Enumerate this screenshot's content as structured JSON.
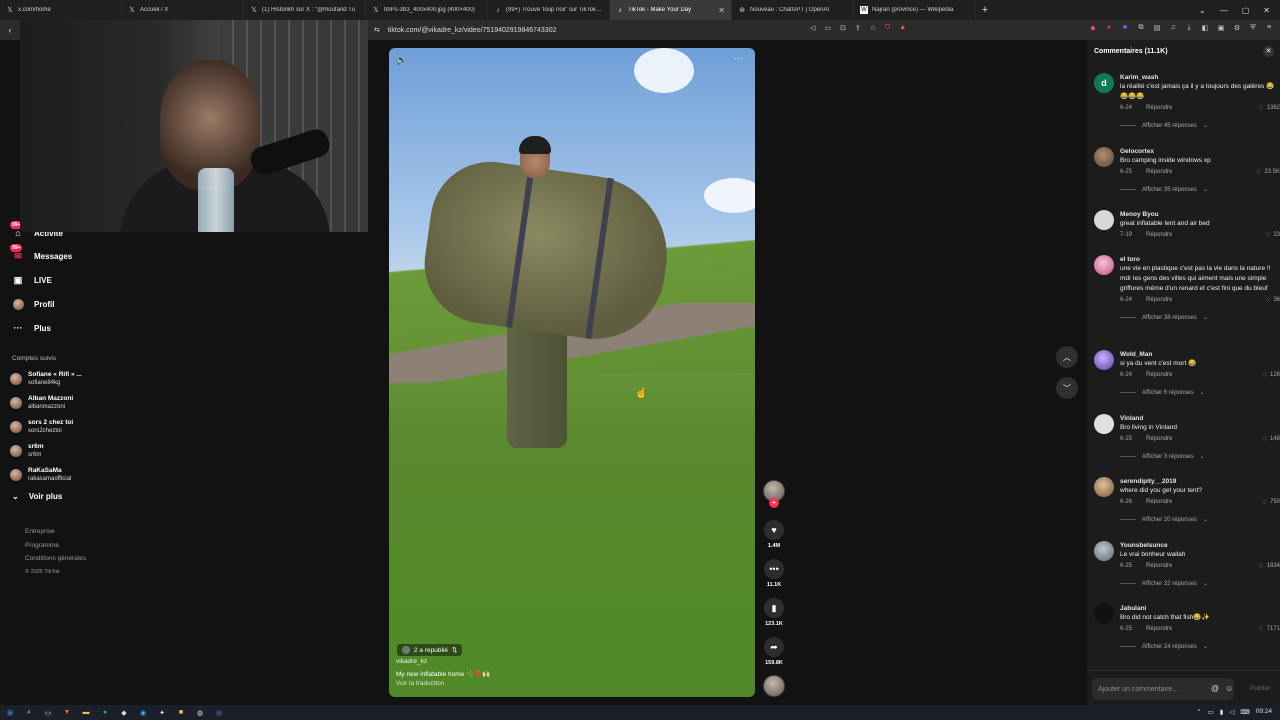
{
  "browser": {
    "tabs": [
      {
        "icon": "x-logo",
        "title": "x.com/home",
        "active": false
      },
      {
        "icon": "x-logo",
        "title": "Accueil / X",
        "active": false
      },
      {
        "icon": "x-logo",
        "title": "(1) Historikh sur X : \"@moufarid Tu",
        "active": false
      },
      {
        "icon": "x-logo",
        "title": "tmPs-3b3_400x400.jpg (400×400)",
        "active": false
      },
      {
        "icon": "tiktok-logo",
        "title": "(99+) Trouve 'loup noir' sur TikTok | R",
        "active": false
      },
      {
        "icon": "tiktok-logo",
        "title": "TikTok - Make Your Day",
        "active": true
      },
      {
        "icon": "openai-logo",
        "title": "Nouveau : ChatGPT | OpenAI",
        "active": false
      },
      {
        "icon": "wikipedia-logo",
        "title": "Najran (province) — Wikipédia",
        "active": false
      }
    ],
    "url": "tiktok.com/@vikadre_kz/video/7519402919846743302"
  },
  "sidebar": {
    "nav": [
      {
        "icon": "activity-icon",
        "label": "Activité",
        "badge": "99+"
      },
      {
        "icon": "messages-icon",
        "label": "Messages",
        "badge": "99+"
      },
      {
        "icon": "live-icon",
        "label": "LIVE",
        "badge": ""
      },
      {
        "icon": "profile-icon",
        "label": "Profil",
        "badge": ""
      },
      {
        "icon": "more-icon",
        "label": "Plus",
        "badge": ""
      }
    ],
    "followed_title": "Comptes suivis",
    "followed": [
      {
        "name": "Sofiane « Rifi » ...",
        "user": "sofiane84kg"
      },
      {
        "name": "Alban Mazzoni",
        "user": "albanmazzoni"
      },
      {
        "name": "sors 2 chez toi",
        "user": "sors2cheztoi"
      },
      {
        "name": "sr6m",
        "user": "sr6m"
      },
      {
        "name": "RaKaSaMa",
        "user": "rakasamaofficial"
      }
    ],
    "see_more": "Voir plus",
    "footer": [
      "Entreprise",
      "Programme",
      "Conditions générales"
    ],
    "copyright": "© 2025 TikTok"
  },
  "video": {
    "republished": "2 a republié",
    "username": "vikadre_kz",
    "caption": "My new inflatable home 🤸‍♂️🎈🙌🏻",
    "translation": "Voir la traduction"
  },
  "actions": {
    "likes": "1.4M",
    "comments": "11.1K",
    "saves": "123.1K",
    "shares": "159.8K"
  },
  "comments": {
    "header": "Commentaires (11.1K)",
    "reply_label": "Répondre",
    "items": [
      {
        "user": "Karim_wash",
        "text": "la réalité c'est jamais ça il y a toujours des galères 😂😂😂😂",
        "date": "6-24",
        "likes": "1362",
        "replies": "Afficher 45 réponses",
        "initial": "d"
      },
      {
        "user": "Gelocortex",
        "text": "Bro camping inside windows xp",
        "date": "6-25",
        "likes": "23.5K",
        "replies": "Afficher 35 réponses",
        "initial": ""
      },
      {
        "user": "Menoy Byou",
        "text": "great inflatable tent and air bed",
        "date": "7-19",
        "likes": "23",
        "replies": "",
        "initial": ""
      },
      {
        "user": "el toro",
        "text": "une vie en plastique c'est pas la vie dans la nature !! mdr les gens des villes qui aiment mais une simple griffures même d'un renard et c'est fini que du bleuf",
        "date": "6-24",
        "likes": "36",
        "replies": "Afficher 38 réponses",
        "initial": ""
      },
      {
        "user": "Wold_Man",
        "text": "si ya du vent c'est mort 😂",
        "date": "6-24",
        "likes": "126",
        "replies": "Afficher 6 réponses",
        "initial": ""
      },
      {
        "user": "Vinland",
        "text": "Bro living in Vinland",
        "date": "6-25",
        "likes": "148",
        "replies": "Afficher 3 réponses",
        "initial": ""
      },
      {
        "user": "serendipity__2019",
        "text": "where did you get your tent?",
        "date": "6-26",
        "likes": "750",
        "replies": "Afficher 20 réponses",
        "initial": ""
      },
      {
        "user": "Younsbelsunce",
        "text": "Le vrai bonheur wallah",
        "date": "6-25",
        "likes": "1834",
        "replies": "Afficher 32 réponses",
        "initial": ""
      },
      {
        "user": "Jabulani",
        "text": "Bro did not catch that fish😂✨",
        "date": "6-25",
        "likes": "7171",
        "replies": "Afficher 24 réponses",
        "initial": ""
      }
    ],
    "input_placeholder": "Ajouter un commentaire...",
    "post_label": "Publier"
  },
  "taskbar": {
    "time": "09:24"
  }
}
